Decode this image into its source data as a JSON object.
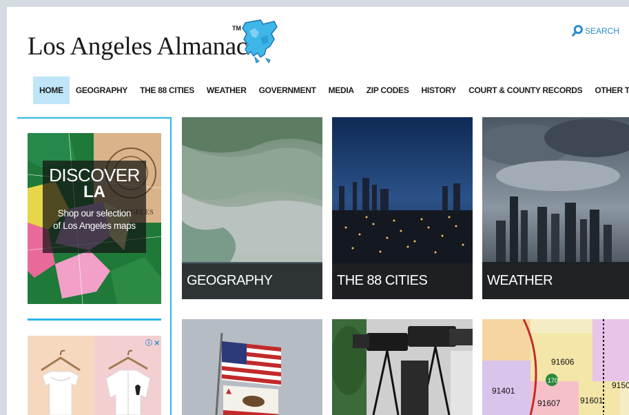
{
  "header": {
    "site_title": "Los Angeles Almanac",
    "trademark": "TM",
    "search_label": "SEARCH"
  },
  "nav": {
    "items": [
      {
        "label": "HOME",
        "active": true
      },
      {
        "label": "GEOGRAPHY"
      },
      {
        "label": "THE 88 CITIES"
      },
      {
        "label": "WEATHER"
      },
      {
        "label": "GOVERNMENT"
      },
      {
        "label": "MEDIA"
      },
      {
        "label": "ZIP CODES"
      },
      {
        "label": "HISTORY"
      },
      {
        "label": "COURT & COUNTY RECORDS"
      },
      {
        "label": "OTHER TOPICS"
      }
    ]
  },
  "sidebar": {
    "map_ad": {
      "title": "DISCOVER",
      "subtitle": "LA",
      "line1": "Shop our selection",
      "line2": "of Los Angeles maps",
      "map_text": "LOS ANGELES"
    },
    "shirt_ad": {
      "ad_choice": "ⓘ ✕"
    }
  },
  "tiles": [
    {
      "label": "GEOGRAPHY"
    },
    {
      "label": "THE 88 CITIES"
    },
    {
      "label": "WEATHER"
    },
    {
      "label": ""
    },
    {
      "label": ""
    },
    {
      "label": "",
      "zip_labels": [
        "91606",
        "91401",
        "91601",
        "91607",
        "170",
        "9150"
      ]
    }
  ],
  "colors": {
    "accent": "#29b4ea",
    "nav_active": "#bfe6f8",
    "search": "#2a8bd1"
  }
}
